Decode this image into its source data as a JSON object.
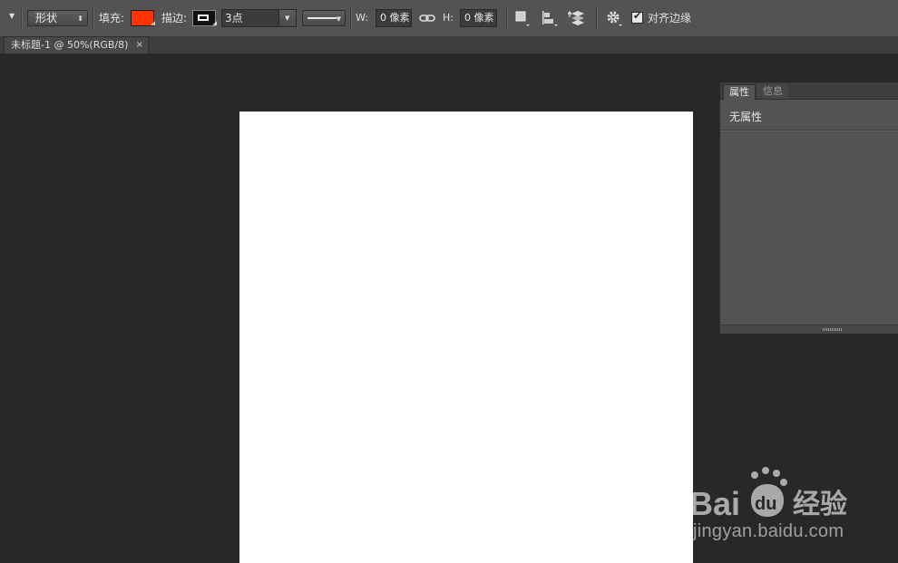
{
  "options_bar": {
    "mode_dropdown": "形状",
    "fill_label": "填充:",
    "fill_color": "#ff3300",
    "stroke_label": "描边:",
    "stroke_size": "3点",
    "width_label": "W:",
    "width_value": "0 像素",
    "height_label": "H:",
    "height_value": "0 像素",
    "align_edges_checked": true,
    "align_edges_label": "对齐边缘"
  },
  "document_tab": {
    "title": "未标题-1 @ 50%(RGB/8)",
    "close": "×"
  },
  "properties_panel": {
    "tabs": [
      "属性",
      "信息"
    ],
    "content": "无属性"
  },
  "watermark": {
    "logo": "Bai du 经验",
    "url": "jingyan.baidu.com"
  }
}
